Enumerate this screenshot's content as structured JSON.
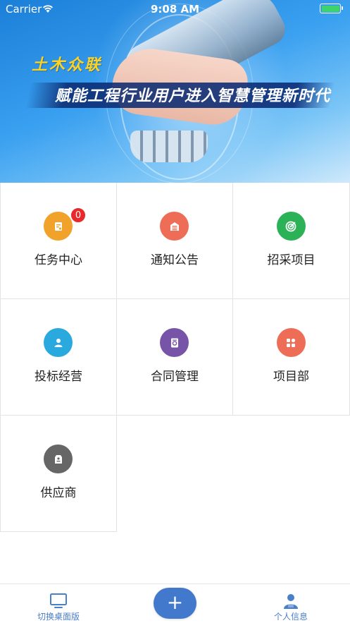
{
  "status_bar": {
    "carrier": "Carrier",
    "time": "9:08 AM"
  },
  "banner": {
    "brand": "土木众联",
    "slogan": "赋能工程行业用户进入智慧管理新时代"
  },
  "modules": [
    {
      "label": "任务中心",
      "icon": "task-icon",
      "color": "#f0a22a",
      "badge": "0"
    },
    {
      "label": "通知公告",
      "icon": "notice-icon",
      "color": "#ee6d57"
    },
    {
      "label": "招采项目",
      "icon": "target-icon",
      "color": "#2bb257"
    },
    {
      "label": "投标经营",
      "icon": "person-icon",
      "color": "#29a9dd"
    },
    {
      "label": "合同管理",
      "icon": "contract-icon",
      "color": "#7754a8"
    },
    {
      "label": "项目部",
      "icon": "apps-icon",
      "color": "#ee6d57"
    },
    {
      "label": "供应商",
      "icon": "supplier-icon",
      "color": "#666666"
    }
  ],
  "tab_bar": {
    "left_label": "切换桌面版",
    "add_label": "+",
    "right_label": "个人信息"
  },
  "colors": {
    "accent": "#4379cc",
    "badge": "#e8282b",
    "brand_yellow": "#ffd21f"
  }
}
